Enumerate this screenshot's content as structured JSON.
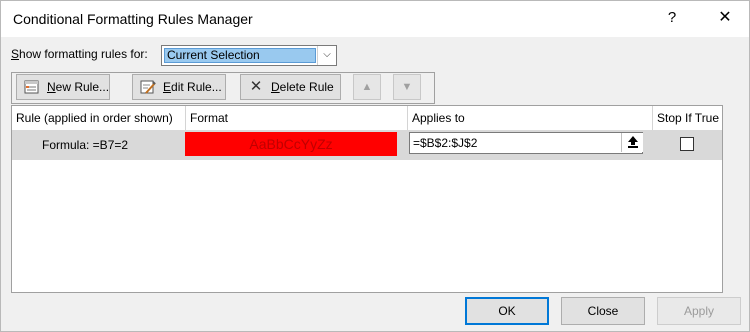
{
  "window": {
    "title": "Conditional Formatting Rules Manager",
    "help": "?",
    "close": "✕"
  },
  "scope": {
    "label_prefix": "",
    "label_underlined": "S",
    "label_rest": "how formatting rules for:",
    "selected": "Current Selection"
  },
  "toolbar": {
    "new_rule_u": "N",
    "new_rule_rest": "ew Rule...",
    "edit_rule_u": "E",
    "edit_rule_rest": "dit Rule...",
    "delete_rule_x": "✕",
    "delete_rule_u": "D",
    "delete_rule_rest": "elete Rule",
    "move_up": "▲",
    "move_down": "▼"
  },
  "table": {
    "headers": [
      "Rule (applied in order shown)",
      "Format",
      "Applies to",
      "Stop If True"
    ],
    "rows": [
      {
        "rule": "Formula: =B7=2",
        "format_preview": "AaBbCcYyZz",
        "applies_to": "=$B$2:$J$2",
        "stop_if_true": false
      }
    ]
  },
  "footer": {
    "ok": "OK",
    "close": "Close",
    "apply": "Apply"
  },
  "colors": {
    "format_fill": "#ff0000",
    "selection_highlight": "#99c9ef",
    "focus_border": "#0078d7"
  }
}
